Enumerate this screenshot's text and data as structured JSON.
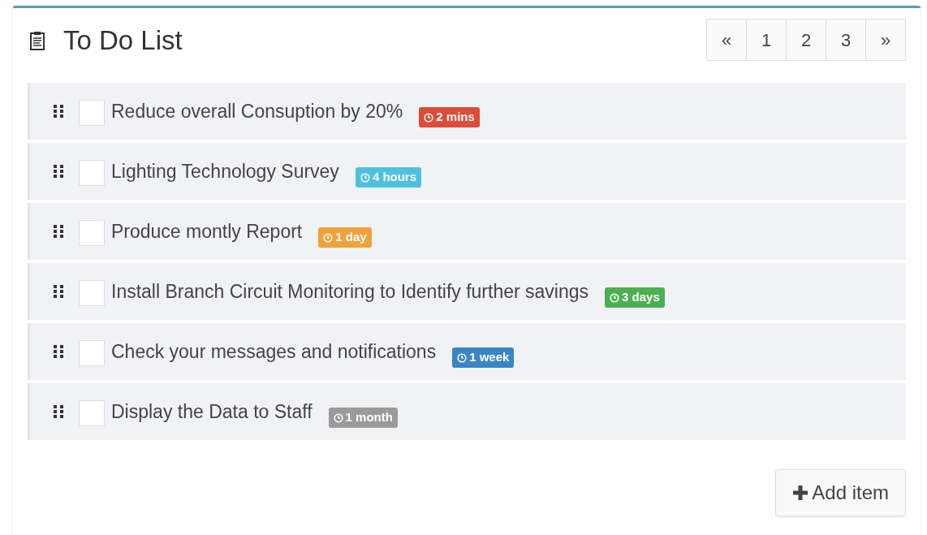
{
  "box": {
    "title": "To Do List"
  },
  "pagination": [
    "«",
    "1",
    "2",
    "3",
    "»"
  ],
  "items": [
    {
      "text": "Reduce overall Consuption by 20%",
      "checked": false,
      "badge": "2 mins",
      "color": "#dd4b39"
    },
    {
      "text": "Lighting Technology Survey",
      "checked": false,
      "badge": "4 hours",
      "color": "#4fc1e0"
    },
    {
      "text": "Produce montly Report",
      "checked": false,
      "badge": "1 day",
      "color": "#f0a23a"
    },
    {
      "text": "Install Branch Circuit Monitoring to Identify further savings",
      "checked": false,
      "badge": "3 days",
      "color": "#4cb050"
    },
    {
      "text": "Check your messages and notifications",
      "checked": false,
      "badge": "1 week",
      "color": "#3a85c6"
    },
    {
      "text": "Display the Data to Staff",
      "checked": false,
      "badge": "1 month",
      "color": "#9a9a9a"
    }
  ],
  "add_button": "Add item"
}
